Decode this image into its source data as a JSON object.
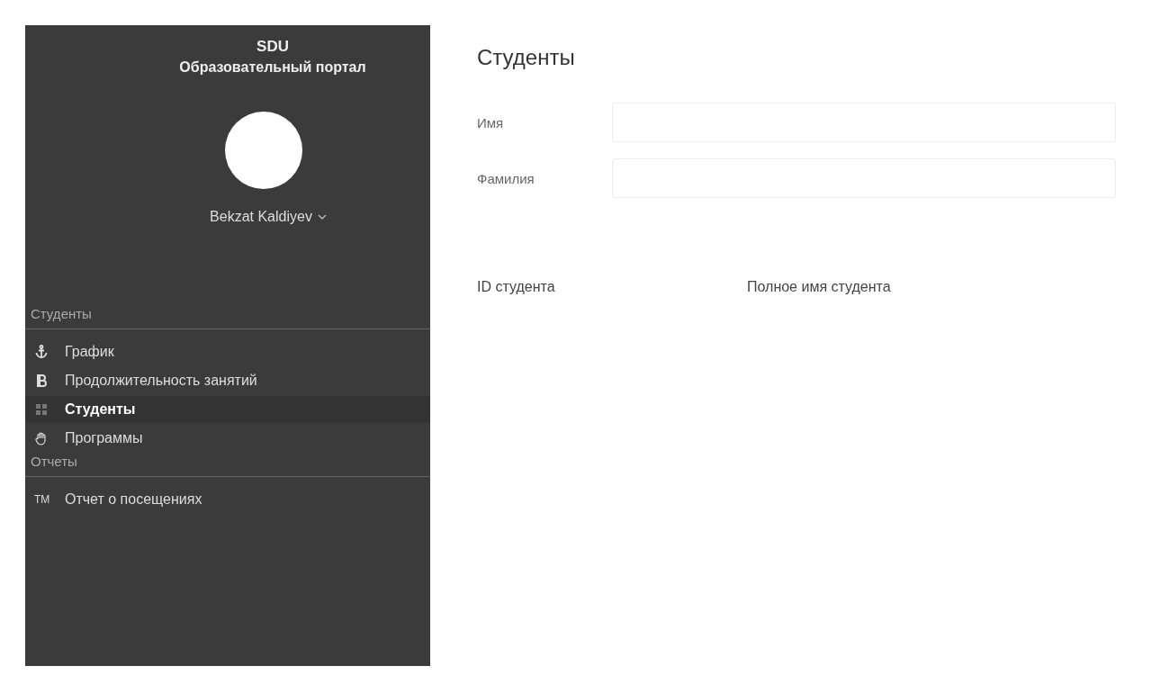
{
  "sidebar": {
    "brand": "SDU",
    "subtitle": "Образовательный портал",
    "user": {
      "name": "Bekzat Kaldiyev"
    },
    "sections": [
      {
        "title": "Студенты",
        "items": [
          {
            "label": "График",
            "selected": false
          },
          {
            "label": "Продолжительность занятий",
            "selected": false
          },
          {
            "label": "Студенты",
            "selected": true
          },
          {
            "label": "Программы",
            "selected": false
          }
        ]
      },
      {
        "title": "Отчеты",
        "items": [
          {
            "label": "Отчет о посещениях",
            "selected": false,
            "glyph": "TM"
          }
        ]
      }
    ]
  },
  "main": {
    "title": "Студенты",
    "fields": [
      {
        "label": "Имя"
      },
      {
        "label": "Фамилия"
      }
    ],
    "table": {
      "columns": [
        "ID студента",
        "Полное имя студента"
      ]
    }
  }
}
